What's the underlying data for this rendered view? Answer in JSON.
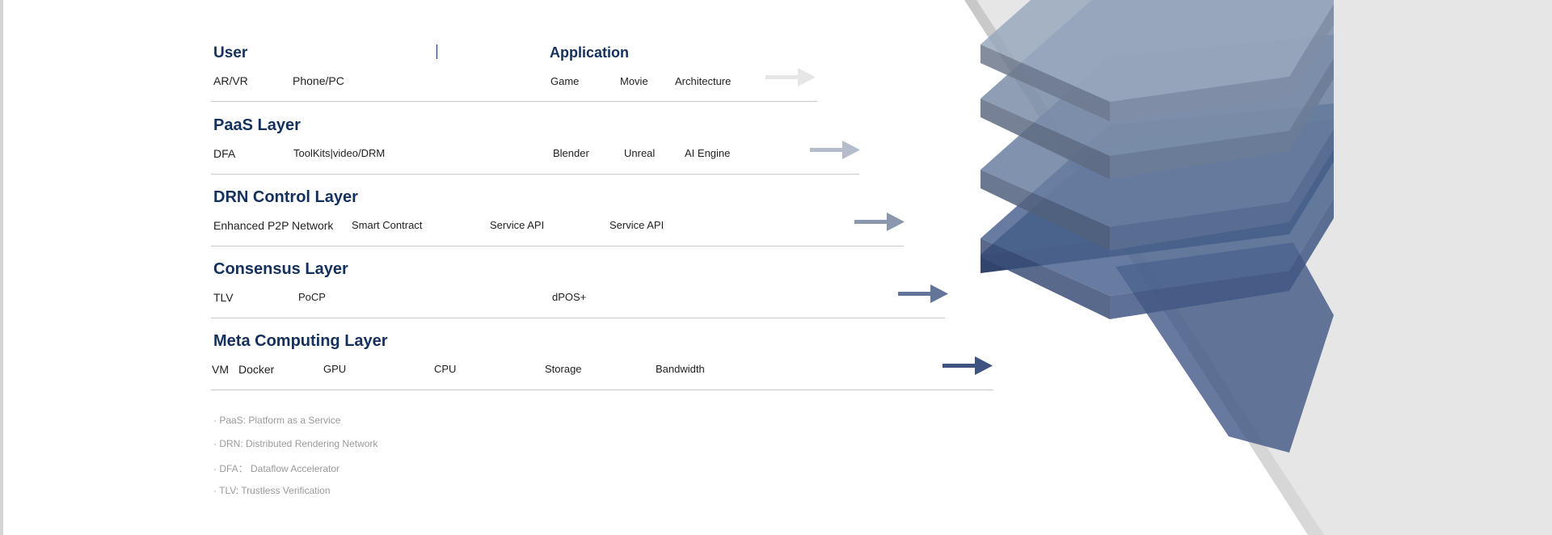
{
  "user_row": {
    "title": "User",
    "items": [
      "AR/VR",
      "Phone/PC"
    ],
    "app_title": "Application",
    "app_items": [
      "Game",
      "Movie",
      "Architecture"
    ]
  },
  "layers": [
    {
      "title": "PaaS Layer",
      "items": [
        "DFA",
        "ToolKits|video/DRM",
        "Blender",
        "Unreal",
        "AI Engine"
      ]
    },
    {
      "title": "DRN Control Layer",
      "items": [
        "Enhanced P2P Network",
        "Smart Contract",
        "Service API",
        "Service API"
      ]
    },
    {
      "title": "Consensus Layer",
      "items": [
        "TLV",
        "PoCP",
        "dPOS+"
      ]
    },
    {
      "title": "Meta Computing Layer",
      "items": [
        "VM",
        "Docker",
        "GPU",
        "CPU",
        "Storage",
        "Bandwidth"
      ]
    }
  ],
  "notes": [
    "· PaaS: Platform as a Service",
    "· DRN: Distributed Rendering Network",
    "· DFA： Dataflow Accelerator",
    "· TLV: Trustless Verification"
  ],
  "colors": {
    "title": "#14305c",
    "arrows": [
      "#e6e6e6",
      "#b4bccb",
      "#8b97ad",
      "#64759a",
      "#3e5380"
    ],
    "stack_plates": [
      "#8d9db5",
      "#7c8ea9",
      "#6a7fa0",
      "#4d6690",
      "#2e4a77"
    ]
  }
}
